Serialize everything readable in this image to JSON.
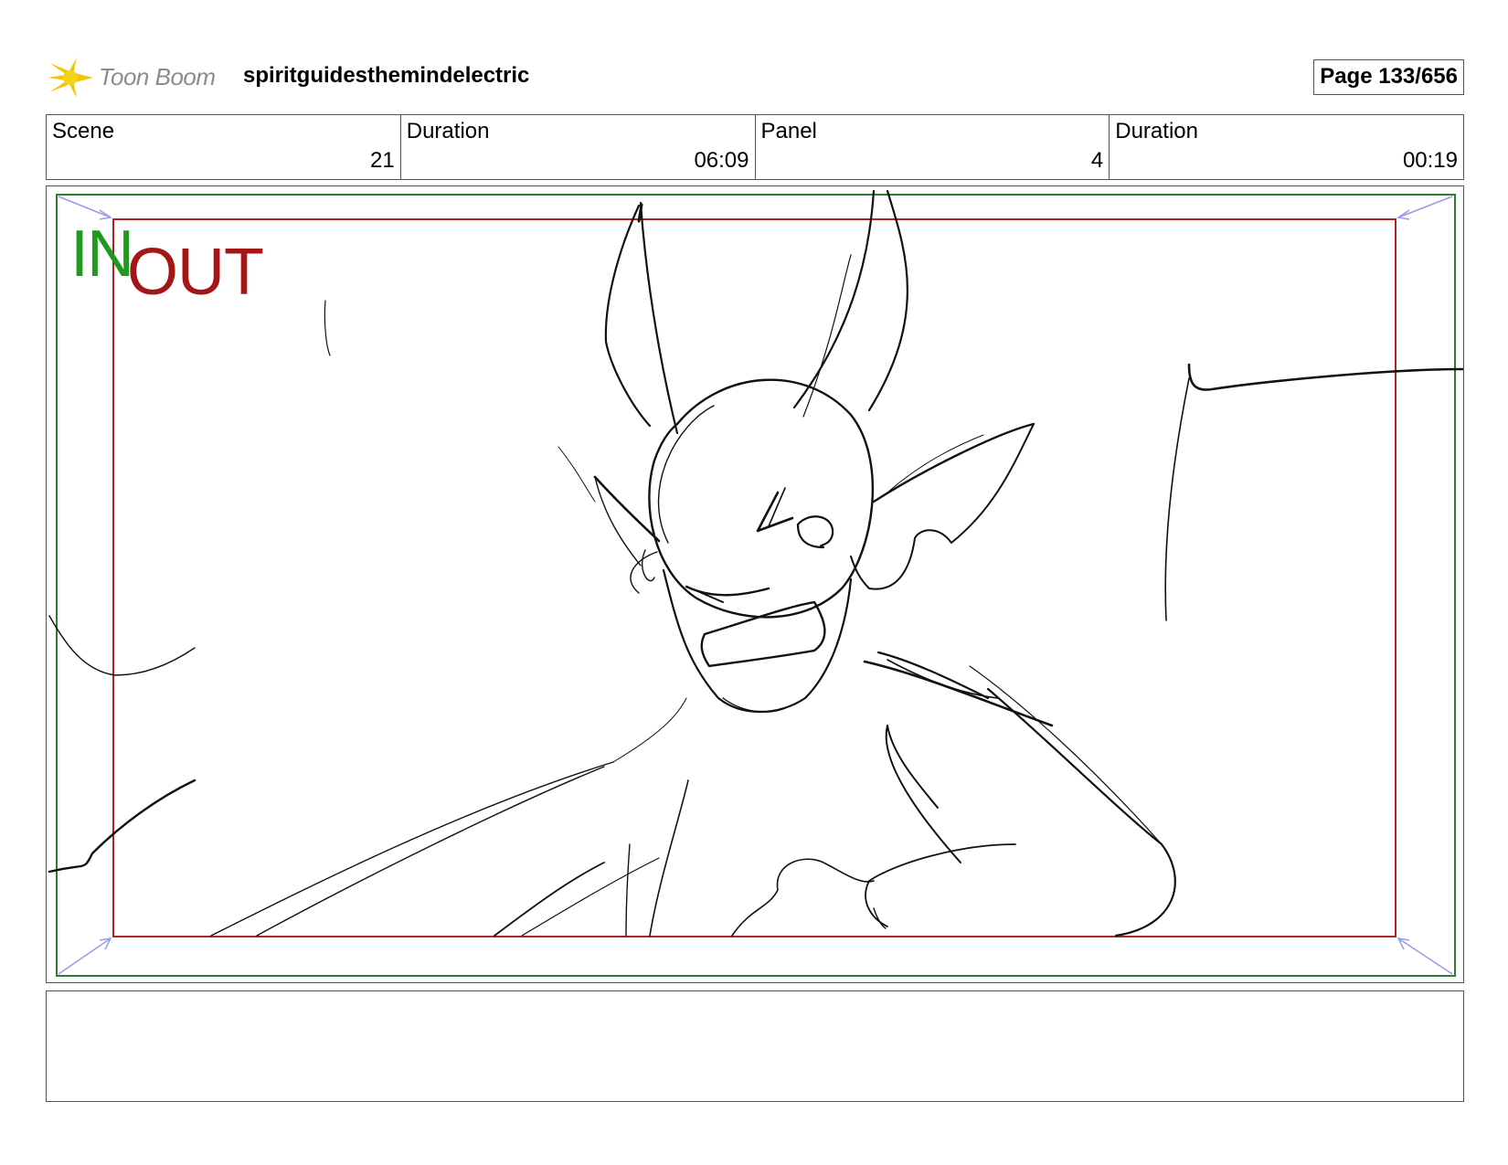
{
  "header": {
    "logo_text": "Toon Boom",
    "project_title": "spiritguidesthemindelectric",
    "page_label": "Page 133/656"
  },
  "info": {
    "scene_label": "Scene",
    "scene_value": "21",
    "scene_duration_label": "Duration",
    "scene_duration_value": "06:09",
    "panel_label": "Panel",
    "panel_value": "4",
    "panel_duration_label": "Duration",
    "panel_duration_value": "00:19"
  },
  "panel": {
    "in_label": "IN",
    "out_label": "OUT",
    "in_color": "#1f9a1f",
    "out_color": "#a51616",
    "camera_frame_color": "#2e7d32",
    "safe_frame_color": "#b22222"
  },
  "notes": {
    "text": ""
  }
}
